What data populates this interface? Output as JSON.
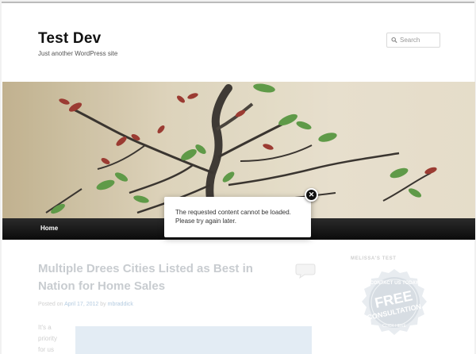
{
  "site": {
    "title": "Test Dev",
    "description": "Just another WordPress site"
  },
  "search": {
    "placeholder": "Search"
  },
  "nav": {
    "items": [
      {
        "label": "Home"
      }
    ]
  },
  "post": {
    "title": "Multiple Drees Cities Listed as Best in Nation for Home Sales",
    "posted_prefix": "Posted on",
    "date": "April 17, 2012",
    "by": "by",
    "author": "mbraddick",
    "excerpt": "It's a priority for us"
  },
  "sidebar": {
    "widget_title": "MELISSA'S TEST",
    "badge": {
      "top": "CONTACT US TODAY",
      "main1": "FREE",
      "main2": "CONSULTATION",
      "bottom": "CLICK HERE"
    }
  },
  "dialog": {
    "message": "The requested content cannot be loaded. Please try again later.",
    "close_symbol": "✕"
  }
}
